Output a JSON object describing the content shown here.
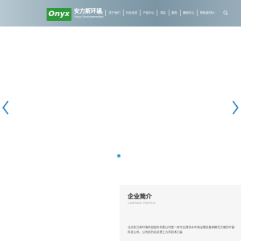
{
  "header": {
    "logo": {
      "mark": "Onyx",
      "name_cn": "安力斯环境",
      "name_en": "Onyx Environmental",
      "brand_color": "#2f9a3b"
    },
    "nav": [
      {
        "label": "首页"
      },
      {
        "label": "关于我们"
      },
      {
        "label": "行业动态"
      },
      {
        "label": "产品中心"
      },
      {
        "label": "项目"
      },
      {
        "label": "服务"
      },
      {
        "label": "案例中心"
      },
      {
        "label": "联系我们"
      }
    ],
    "lang_label": "En",
    "search_icon": "search-icon"
  },
  "slider": {
    "prev_icon": "chevron-left-icon",
    "next_icon": "chevron-right-icon",
    "accent": "#2b9ad6"
  },
  "profile": {
    "title": "企业简介",
    "subtitle": "COMPANY PROFILE",
    "text": "北京安力斯环境科技股份有限公司是一家专业提供水环境治理设备和解决方案的环保科技公司。公司依托北京理工大学技术力量"
  }
}
